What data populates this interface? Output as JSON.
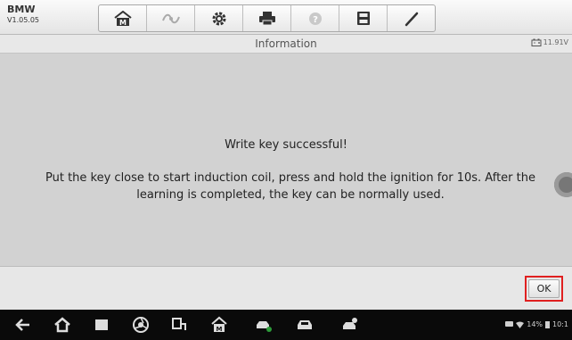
{
  "brand": {
    "name": "BMW",
    "version": "V1.05.05"
  },
  "toolbar": {
    "icons": [
      "home-icon",
      "vci-icon",
      "settings-icon",
      "print-icon",
      "help-icon",
      "save-icon",
      "data-logging-icon"
    ]
  },
  "titlebar": {
    "title": "Information",
    "voltage": "11.91V"
  },
  "message": {
    "title": "Write key successful!",
    "body": "Put the key close to start induction coil, press and hold the ignition for 10s. After the learning is completed, the key can be normally used."
  },
  "footer": {
    "ok_label": "OK",
    "highlight_color": "#e02020"
  },
  "navbar": {
    "icons": [
      "back-icon",
      "home-icon",
      "recent-apps-icon",
      "browser-icon",
      "vci-connect-icon",
      "maxisys-home-icon",
      "service-car-icon",
      "car-icon",
      "shop-car-icon"
    ],
    "status": {
      "battery": "14%",
      "time": "10:1"
    }
  }
}
